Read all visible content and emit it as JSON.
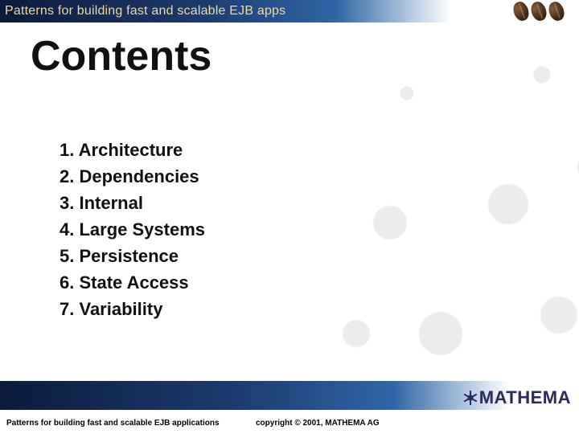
{
  "header": {
    "title": "Patterns for building fast and scalable EJB apps"
  },
  "page": {
    "title": "Contents"
  },
  "toc": {
    "items": [
      {
        "n": "1.",
        "label": "Architecture"
      },
      {
        "n": "2.",
        "label": "Dependencies"
      },
      {
        "n": "3.",
        "label": "Internal"
      },
      {
        "n": "4.",
        "label": "Large Systems"
      },
      {
        "n": "5.",
        "label": "Persistence"
      },
      {
        "n": "6.",
        "label": "State Access"
      },
      {
        "n": "7.",
        "label": "Variability"
      }
    ]
  },
  "footer": {
    "left": "Patterns for building fast and scalable EJB applications",
    "copyright": "copyright © 2001, MATHEMA AG",
    "logo_text": "MATHEMA"
  }
}
